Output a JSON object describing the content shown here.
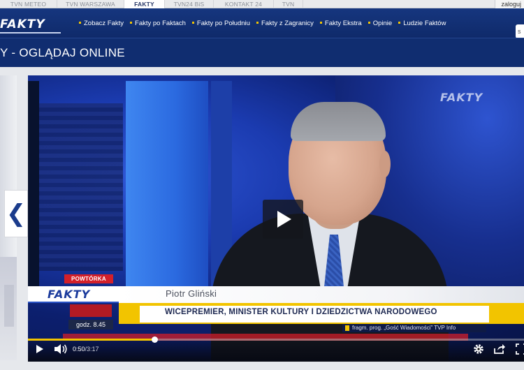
{
  "network_tabs": [
    {
      "label": "TVN METEO",
      "active": false
    },
    {
      "label": "TVN WARSZAWA",
      "active": false
    },
    {
      "label": "FAKTY",
      "active": true
    },
    {
      "label": "TVN24 BiS",
      "active": false
    },
    {
      "label": "KONTAKT 24",
      "active": false
    },
    {
      "label": "TVN",
      "active": false
    }
  ],
  "login_label": "zaloguj",
  "logo_text": "FAKTY",
  "menu": [
    "Zobacz Fakty",
    "Fakty po Faktach",
    "Fakty po Południu",
    "Fakty z Zagranicy",
    "Fakty Ekstra",
    "Opinie",
    "Ludzie Faktów"
  ],
  "search_partial": "s",
  "page_title": "Y - OGLĄDAJ ONLINE",
  "video": {
    "channel_bug": "FAKTY",
    "powtorka": "POWTÓRKA",
    "lower_third_logo": "FAKTY",
    "person_name": "Piotr Gliński",
    "person_role": "WICEPREMIER, MINISTER KULTURY I DZIEDZICTWA NARODOWEGO",
    "clock": "godz. 8.45",
    "fragment_caption": "fragm. prog. „Gość Wiadomości” TVP Info"
  },
  "controls": {
    "current_time": "0:50",
    "separator": "/",
    "duration": "3:17",
    "progress_fraction": 0.2538
  },
  "colors": {
    "brand_blue": "#102d70",
    "accent_yellow": "#f2c400",
    "alert_red": "#d3202a"
  },
  "icons": [
    "chevron-left-icon",
    "play-icon",
    "volume-icon",
    "gear-icon",
    "share-icon",
    "fullscreen-icon"
  ]
}
